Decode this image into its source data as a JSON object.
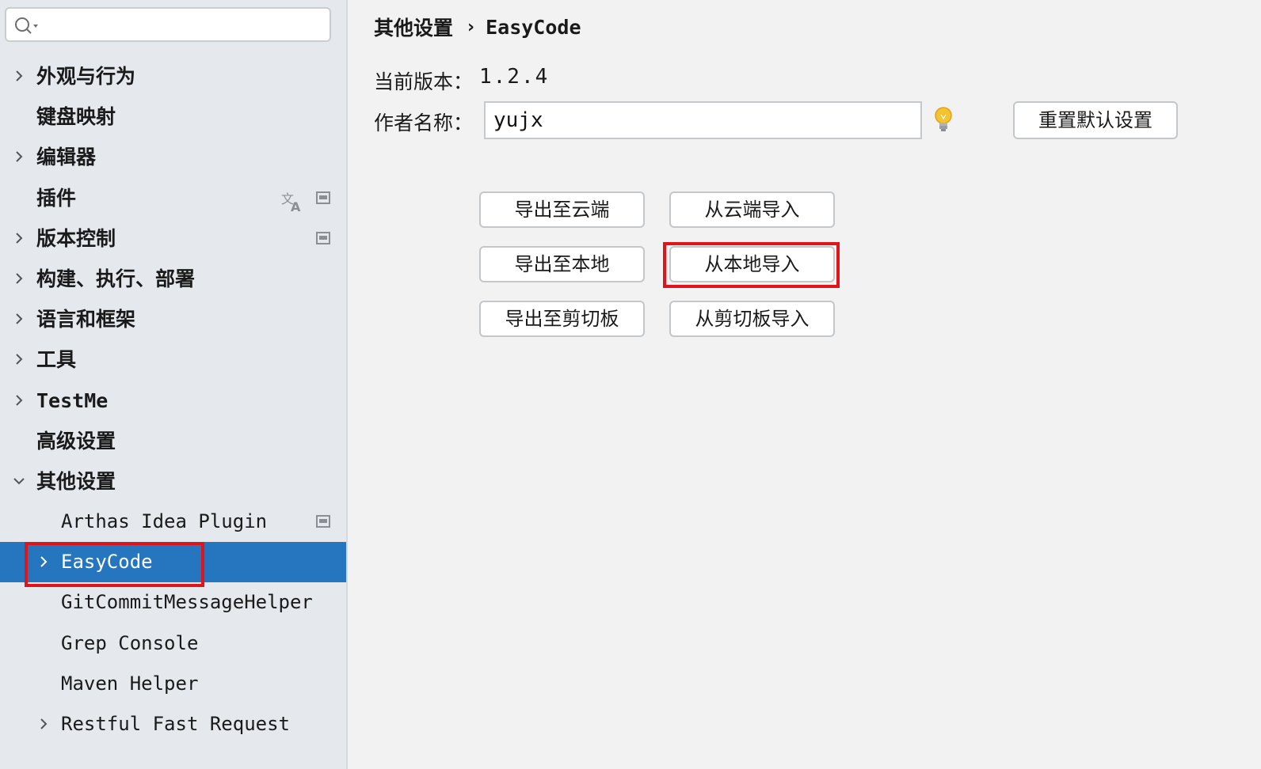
{
  "search": {
    "placeholder": ""
  },
  "sidebar": {
    "items": [
      {
        "label": "外观与行为"
      },
      {
        "label": "键盘映射"
      },
      {
        "label": "编辑器"
      },
      {
        "label": "插件"
      },
      {
        "label": "版本控制"
      },
      {
        "label": "构建、执行、部署"
      },
      {
        "label": "语言和框架"
      },
      {
        "label": "工具"
      },
      {
        "label": "TestMe"
      },
      {
        "label": "高级设置"
      },
      {
        "label": "其他设置"
      },
      {
        "label": "Arthas Idea Plugin"
      },
      {
        "label": "EasyCode"
      },
      {
        "label": "GitCommitMessageHelper"
      },
      {
        "label": "Grep Console"
      },
      {
        "label": "Maven Helper"
      },
      {
        "label": "Restful Fast Request"
      }
    ],
    "selected": "EasyCode"
  },
  "breadcrumb": {
    "parent": "其他设置",
    "separator": "›",
    "current": "EasyCode"
  },
  "form": {
    "version_label": "当前版本：",
    "version_value": "1.2.4",
    "author_label": "作者名称：",
    "author_value": "yujx",
    "reset_button": "重置默认设置"
  },
  "buttons": {
    "export_cloud": "导出至云端",
    "import_cloud": "从云端导入",
    "export_local": "导出至本地",
    "import_local": "从本地导入",
    "export_clipboard": "导出至剪切板",
    "import_clipboard": "从剪切板导入"
  },
  "colors": {
    "selected_bg": "#2675bf",
    "highlight": "#e0141b"
  }
}
